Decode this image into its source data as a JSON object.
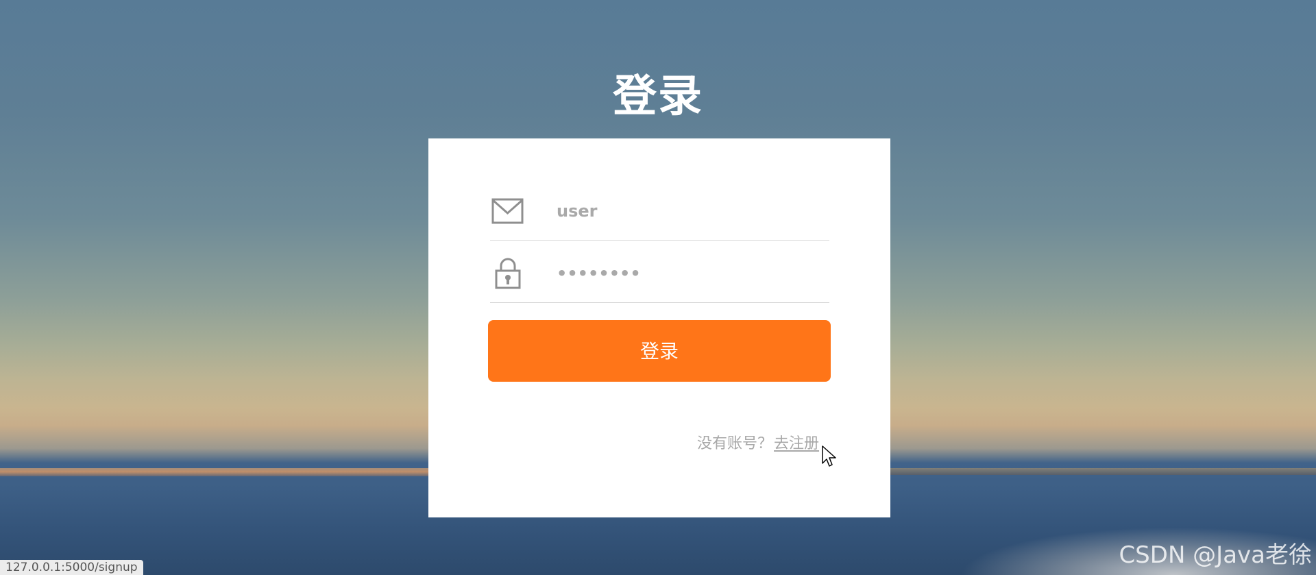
{
  "page": {
    "title": "登录"
  },
  "login_form": {
    "username_value": "user",
    "password_mask": "••••••••",
    "submit_label": "登录",
    "signup_prompt": "没有账号？",
    "signup_link": "去注册"
  },
  "icons": {
    "username": "mail-icon",
    "password": "lock-icon",
    "cursor": "mouse-pointer-icon"
  },
  "status_bar": {
    "url": "127.0.0.1:5000/signup"
  },
  "watermark": {
    "text": "CSDN @Java老徐"
  },
  "colors": {
    "primary_button": "#ff7518",
    "card_background": "#ffffff",
    "muted_text": "#a8a8a8"
  }
}
